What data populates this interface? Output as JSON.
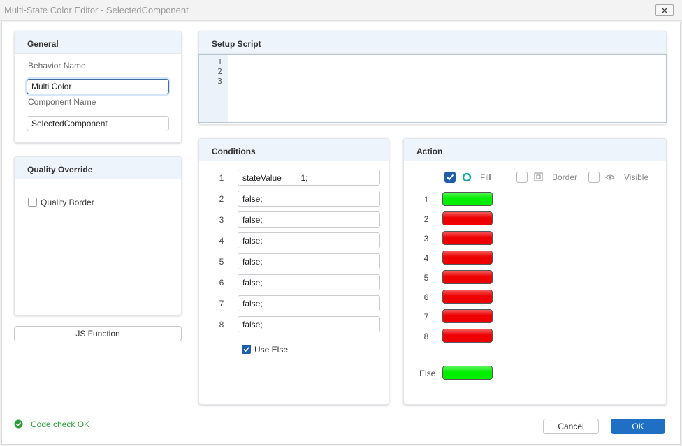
{
  "window": {
    "title": "Multi-State Color Editor - SelectedComponent"
  },
  "general": {
    "header": "General",
    "behavior_label": "Behavior Name",
    "behavior_value": "Multi Color",
    "component_label": "Component Name",
    "component_value": "SelectedComponent"
  },
  "quality": {
    "header": "Quality Override",
    "border_label": "Quality Border",
    "border_checked": false
  },
  "js_function_label": "JS Function",
  "setup_script": {
    "header": "Setup Script",
    "line_numbers": [
      "1",
      "2",
      "3"
    ]
  },
  "conditions": {
    "header": "Conditions",
    "rows": [
      {
        "num": "1",
        "expr": "stateValue === 1;"
      },
      {
        "num": "2",
        "expr": "false;"
      },
      {
        "num": "3",
        "expr": "false;"
      },
      {
        "num": "4",
        "expr": "false;"
      },
      {
        "num": "5",
        "expr": "false;"
      },
      {
        "num": "6",
        "expr": "false;"
      },
      {
        "num": "7",
        "expr": "false;"
      },
      {
        "num": "8",
        "expr": "false;"
      }
    ],
    "use_else_label": "Use Else",
    "use_else_checked": true
  },
  "action": {
    "header": "Action",
    "fill_label": "Fill",
    "border_label": "Border",
    "visible_label": "Visible",
    "rows": [
      {
        "num": "1",
        "color": "#00ee00"
      },
      {
        "num": "2",
        "color": "#ee0000"
      },
      {
        "num": "3",
        "color": "#ee0000"
      },
      {
        "num": "4",
        "color": "#ee0000"
      },
      {
        "num": "5",
        "color": "#ee0000"
      },
      {
        "num": "6",
        "color": "#ee0000"
      },
      {
        "num": "7",
        "color": "#ee0000"
      },
      {
        "num": "8",
        "color": "#ee0000"
      }
    ],
    "else_label": "Else",
    "else_color": "#00ee00"
  },
  "footer": {
    "status_text": "Code check OK",
    "cancel_label": "Cancel",
    "ok_label": "OK"
  },
  "colors": {
    "accent": "#1f6fc5",
    "status_ok": "#2a9d3a"
  }
}
